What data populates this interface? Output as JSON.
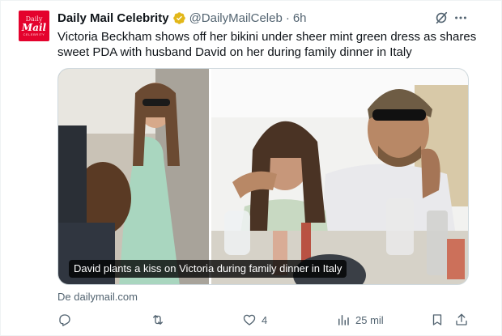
{
  "account": {
    "avatar_line1": "Daily",
    "avatar_line2": "Mail",
    "avatar_line3": "CELEBRITY",
    "name": "Daily Mail Celebrity",
    "handle": "@DailyMailCeleb",
    "separator": "·",
    "time": "6h",
    "verified_color": "#e2b719"
  },
  "tweet": {
    "text": "Victoria Beckham shows off her bikini under sheer mint green dress as shares sweet PDA with husband David on her during family dinner in Italy"
  },
  "media": {
    "caption": "David plants a kiss on Victoria during family dinner in Italy",
    "source": "De dailymail.com"
  },
  "actions": {
    "reply_count": "",
    "retweet_count": "",
    "like_count": "4",
    "views_count": "25 mil"
  },
  "icons": {
    "grok": "grok-icon",
    "more": "more-icon",
    "reply": "reply-icon",
    "retweet": "retweet-icon",
    "like": "heart-icon",
    "views": "views-icon",
    "bookmark": "bookmark-icon",
    "share": "share-icon"
  }
}
